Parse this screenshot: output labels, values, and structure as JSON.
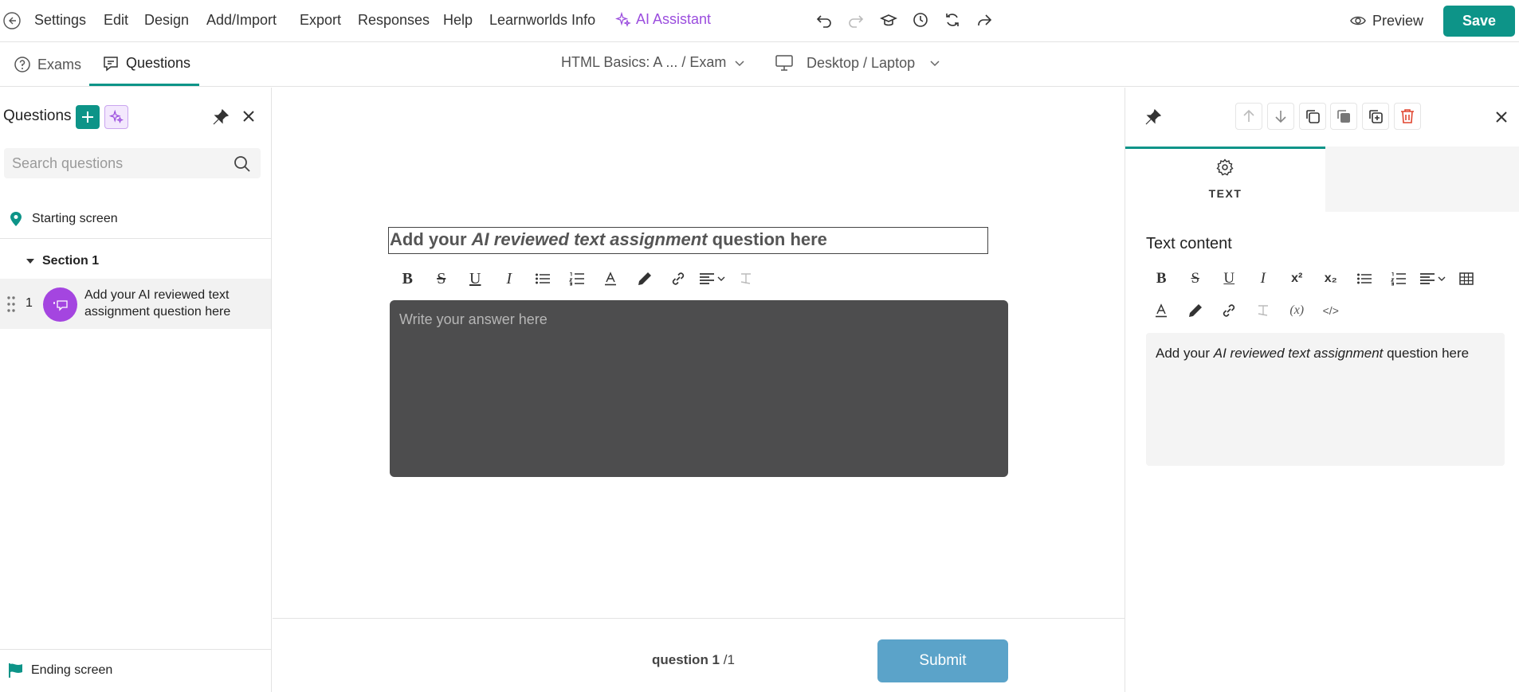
{
  "topbar": {
    "menu": [
      "Settings",
      "Edit",
      "Design",
      "Add/Import",
      "Export",
      "Responses",
      "Help",
      "Learnworlds Info"
    ],
    "ai_assistant": "AI Assistant",
    "preview": "Preview",
    "save": "Save",
    "colors": {
      "accent": "#0d9488",
      "ai": "#9b4dde"
    }
  },
  "subbar": {
    "tabs": [
      {
        "label": "Exams",
        "icon": "help-circle-icon",
        "active": false
      },
      {
        "label": "Questions",
        "icon": "questions-icon",
        "active": true
      }
    ],
    "course_select": "HTML Basics: A ...  / Exam",
    "device_select": "Desktop / Laptop"
  },
  "left": {
    "title": "Questions",
    "search_placeholder": "Search questions",
    "starting_screen": "Starting screen",
    "section": "Section 1",
    "question_number": "1",
    "question_label": "Add your AI reviewed text assignment question here",
    "ending_screen": "Ending screen"
  },
  "center": {
    "question_title": {
      "pre": "Add your ",
      "em": "AI reviewed text assignment",
      "post": " question here"
    },
    "answer_placeholder": "Write your answer here",
    "counter_bold": "question 1",
    "counter_rest": " /1",
    "submit": "Submit",
    "answer_bg": "#4d4d4e",
    "submit_bg": "#5ba3c9"
  },
  "right": {
    "tab_label": "TEXT",
    "section_title": "Text content",
    "editor_content": {
      "pre": "Add your ",
      "em": "AI reviewed text assignment",
      "post": " question here"
    },
    "delete_color": "#e0452f"
  }
}
